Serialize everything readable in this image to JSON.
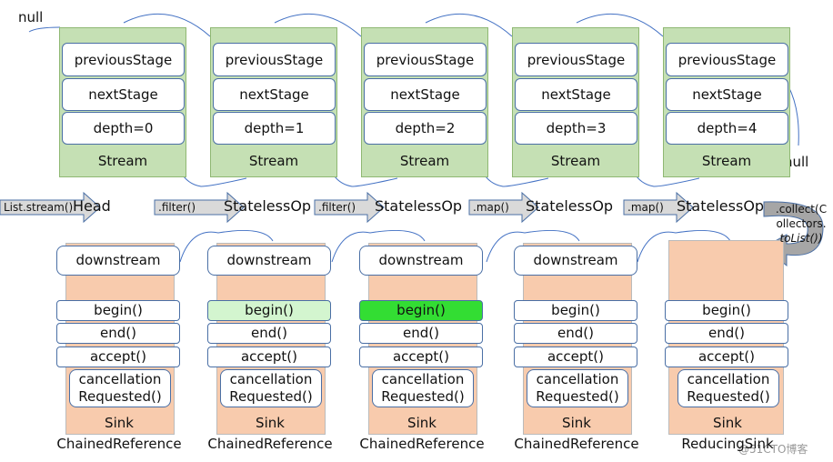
{
  "null_top": "null",
  "null_right": "null",
  "streams": [
    {
      "previous": "previousStage",
      "next": "nextStage",
      "depth": "depth=0",
      "label": "Stream",
      "type": "Head",
      "op": "List.stream()"
    },
    {
      "previous": "previousStage",
      "next": "nextStage",
      "depth": "depth=1",
      "label": "Stream",
      "type": "StatelessOp",
      "op": ".filter()"
    },
    {
      "previous": "previousStage",
      "next": "nextStage",
      "depth": "depth=2",
      "label": "Stream",
      "type": "StatelessOp",
      "op": ".filter()"
    },
    {
      "previous": "previousStage",
      "next": "nextStage",
      "depth": "depth=3",
      "label": "Stream",
      "type": "StatelessOp",
      "op": ".map()"
    },
    {
      "previous": "previousStage",
      "next": "nextStage",
      "depth": "depth=4",
      "label": "Stream",
      "type": "StatelessOp",
      "op": ".map()"
    }
  ],
  "collect": {
    "line1": ".collect(C",
    "line2": "ollectors.",
    "line3": "toList())"
  },
  "sinks": [
    {
      "downstream": "downstream",
      "begin": "begin()",
      "end": "end()",
      "accept": "accept()",
      "cancel1": "cancellation",
      "cancel2": "Requested()",
      "label": "Sink",
      "type": "ChainedReference",
      "begin_color": "#ffffff"
    },
    {
      "downstream": "downstream",
      "begin": "begin()",
      "end": "end()",
      "accept": "accept()",
      "cancel1": "cancellation",
      "cancel2": "Requested()",
      "label": "Sink",
      "type": "ChainedReference",
      "begin_color": "#d3f5cf"
    },
    {
      "downstream": "downstream",
      "begin": "begin()",
      "end": "end()",
      "accept": "accept()",
      "cancel1": "cancellation",
      "cancel2": "Requested()",
      "label": "Sink",
      "type": "ChainedReference",
      "begin_color": "#33dd33"
    },
    {
      "downstream": "downstream",
      "begin": "begin()",
      "end": "end()",
      "accept": "accept()",
      "cancel1": "cancellation",
      "cancel2": "Requested()",
      "label": "Sink",
      "type": "ChainedReference",
      "begin_color": "#ffffff"
    },
    {
      "downstream": null,
      "begin": "begin()",
      "end": "end()",
      "accept": "accept()",
      "cancel1": "cancellation",
      "cancel2": "Requested()",
      "label": "Sink",
      "type": "ReducingSink",
      "begin_color": "#ffffff"
    }
  ],
  "watermark": "@51CTO博客"
}
